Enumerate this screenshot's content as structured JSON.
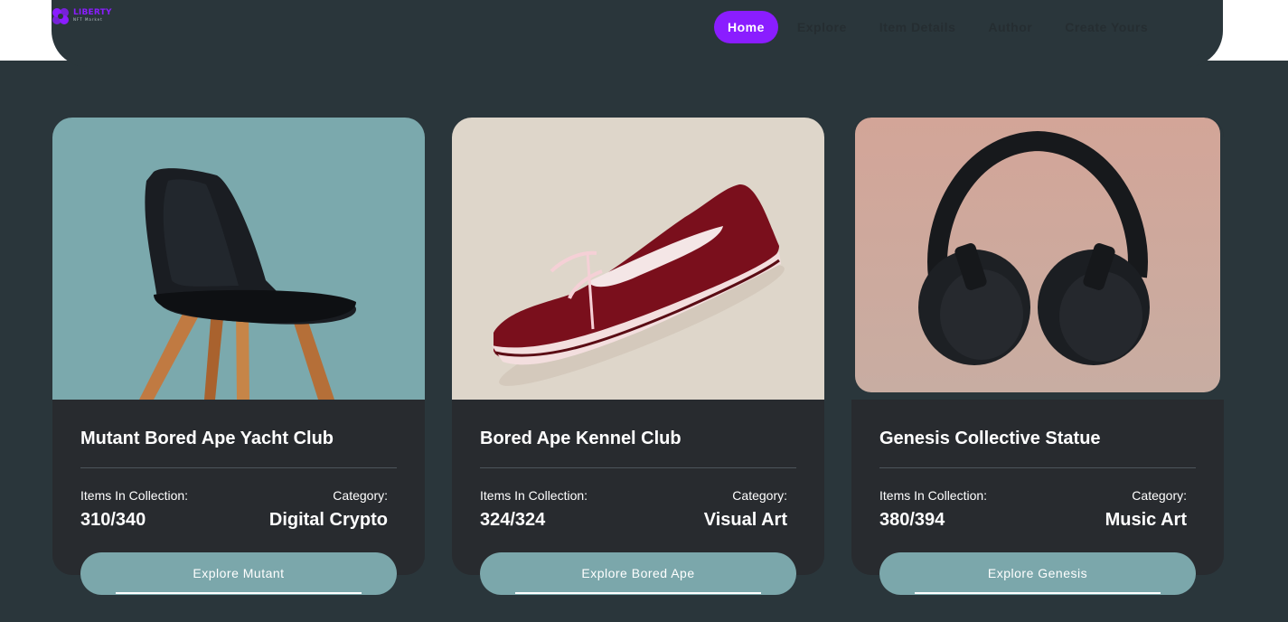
{
  "header": {
    "logo_text": "LIBERTY",
    "logo_subtext": "NFT Market",
    "nav": [
      {
        "label": "Home",
        "active": true
      },
      {
        "label": "Explore",
        "active": false
      },
      {
        "label": "Item Details",
        "active": false
      },
      {
        "label": "Author",
        "active": false
      },
      {
        "label": "Create Yours",
        "active": false
      }
    ]
  },
  "collections": [
    {
      "title": "Mutant Bored Ape Yacht Club",
      "items_label": "Items In Collection:",
      "items_value": "310/340",
      "category_label": "Category:",
      "category_value": "Digital Crypto",
      "button_label": "Explore Mutant",
      "image": "black-chair"
    },
    {
      "title": "Bored Ape Kennel Club",
      "items_label": "Items In Collection:",
      "items_value": "324/324",
      "category_label": "Category:",
      "category_value": "Visual Art",
      "button_label": "Explore Bored Ape",
      "image": "red-sneaker"
    },
    {
      "title": "Genesis Collective Statue",
      "items_label": "Items In Collection:",
      "items_value": "380/394",
      "category_label": "Category:",
      "category_value": "Music Art",
      "button_label": "Explore Genesis",
      "image": "black-headphones"
    }
  ],
  "colors": {
    "page_background": "#2a363b",
    "card_background": "#282b2f",
    "accent": "#8a1dff",
    "button": "#7ba7ab"
  }
}
